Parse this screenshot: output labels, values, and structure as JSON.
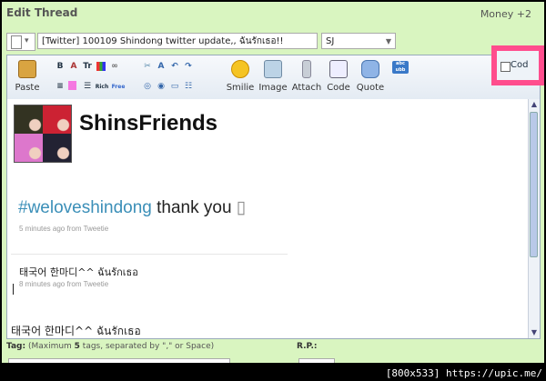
{
  "header": {
    "title": "Edit Thread",
    "money": "Money +2"
  },
  "post": {
    "subject": "[Twitter] 100109 Shindong twitter update,, ฉันรักเธอ!!",
    "prefix": "SJ"
  },
  "toolbar": {
    "paste": "Paste",
    "smilie": "Smilie",
    "image": "Image",
    "attach": "Attach",
    "code": "Code",
    "quote": "Quote",
    "small_b": "B",
    "small_tr": "Tr"
  },
  "content": {
    "profile_name": "ShinsFriends",
    "tweet1_hashtag": "#weloveshindong",
    "tweet1_text": " thank you ",
    "tweet1_glyph": "▯",
    "tweet1_meta_time": "5 minutes ago",
    "tweet1_meta_from": " from Tweetie",
    "tweet2_text": "태국어 한마디^^ ฉันรักเธอ",
    "tweet2_meta_time": "8 minutes ago",
    "tweet2_meta_from": " from Tweetie",
    "tweet3_text": "태국어 한마디^^ ฉันรักเธอ"
  },
  "code_toggle": {
    "label": "Cod"
  },
  "footer": {
    "tag_label": "Tag:",
    "tag_hint_prefix": " (Maximum ",
    "tag_hint_count": "5",
    "tag_hint_suffix": " tags, separated by \",\" or Space)",
    "rp_label": "R.P.:"
  },
  "watermark": "[800x533] https://upic.me/",
  "colors": {
    "background": "#d9f5c0",
    "hashtag": "#3b8fb8",
    "highlight": "#ff4d8d"
  }
}
